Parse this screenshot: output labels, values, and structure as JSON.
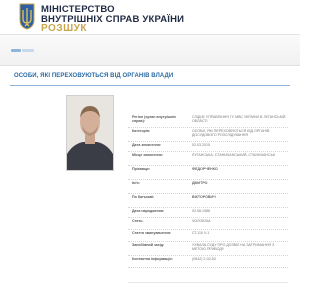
{
  "header": {
    "title_line1": "МІНІСТЕРСТВО",
    "title_line2": "ВНУТРІШНІХ СПРАВ УКРАЇНИ",
    "subtitle": "РОЗШУК"
  },
  "colors": {
    "section_title": "#2a6aa4",
    "ministry_title": "#1f2a44",
    "subtitle": "#c9a64a",
    "rule": "#8fb3d6"
  },
  "page_title": "ОСОБИ, ЯКІ ПЕРЕХОВУЮТЬСЯ ВІД ОРГАНІВ ВЛАДИ",
  "photo": {
    "icon": "person-photo"
  },
  "details": [
    {
      "label": "Регіон (орган внутрішніх справ):",
      "value": "СЛІДЧЕ УПРАВЛІННЯ ГУ МВС УКРАЇНИ В ЛУГАНСЬКІЙ ОБЛАСТІ"
    },
    {
      "label": "Категорія:",
      "value": "ОСОБИ, ЯКІ ПЕРЕХОВУЮТЬСЯ ВІД ОРГАНІВ ДОСУДОВОГО РОЗСЛІДУВАННЯ"
    },
    {
      "label": "Дата зникнення:",
      "value": "02.03.2015"
    },
    {
      "label": "Місце зникнення:",
      "value": "ЛУГАНСЬКА, СТАНИЧАНСЬКИЙ, СТАНИЧАНСЬК"
    },
    {
      "label": "Прізвище:",
      "value": "ФЕДОРЧЕНКО",
      "bold": true
    },
    {
      "label": "Ім'я:",
      "value": "ДМИТРО",
      "bold": true
    },
    {
      "label": "По батькові:",
      "value": "ВІКТОРОВИЧ",
      "bold": true
    },
    {
      "label": "Дата народження:",
      "value": "02.08.1986"
    },
    {
      "label": "Стать:",
      "value": "ЧОЛОВІЧА"
    },
    {
      "label": "Стаття звинувачення:",
      "value": "СТ.110 Ч.1"
    },
    {
      "label": "Запобіжний захід:",
      "value": "УХВАЛА СУДУ ПРО ДОЗВІЛ НА ЗАТРИМАННЯ З МЕТОЮ ПРИВОДУ"
    },
    {
      "label": "Контактна інформація:",
      "value": "(0642) 2-02-53"
    }
  ]
}
